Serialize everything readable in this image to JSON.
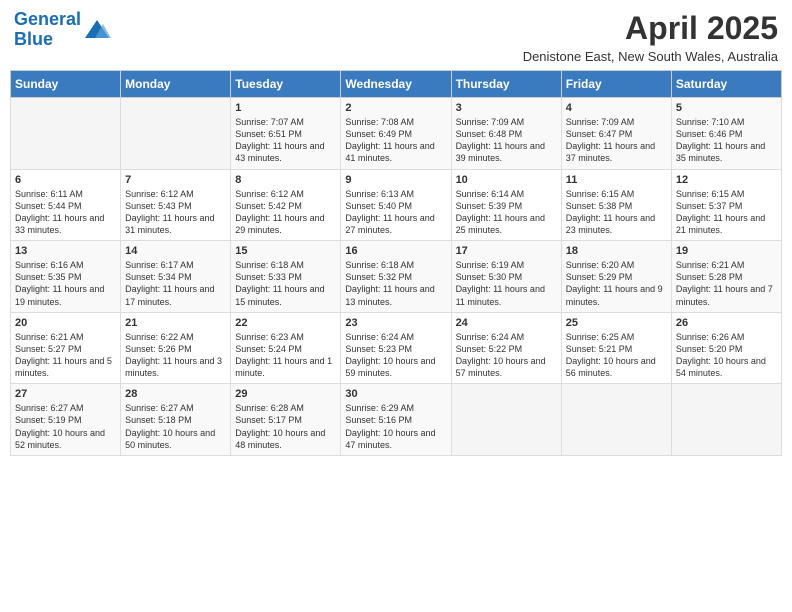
{
  "header": {
    "logo_line1": "General",
    "logo_line2": "Blue",
    "month_title": "April 2025",
    "subtitle": "Denistone East, New South Wales, Australia"
  },
  "weekdays": [
    "Sunday",
    "Monday",
    "Tuesday",
    "Wednesday",
    "Thursday",
    "Friday",
    "Saturday"
  ],
  "weeks": [
    [
      {
        "day": "",
        "info": ""
      },
      {
        "day": "",
        "info": ""
      },
      {
        "day": "1",
        "info": "Sunrise: 7:07 AM\nSunset: 6:51 PM\nDaylight: 11 hours and 43 minutes."
      },
      {
        "day": "2",
        "info": "Sunrise: 7:08 AM\nSunset: 6:49 PM\nDaylight: 11 hours and 41 minutes."
      },
      {
        "day": "3",
        "info": "Sunrise: 7:09 AM\nSunset: 6:48 PM\nDaylight: 11 hours and 39 minutes."
      },
      {
        "day": "4",
        "info": "Sunrise: 7:09 AM\nSunset: 6:47 PM\nDaylight: 11 hours and 37 minutes."
      },
      {
        "day": "5",
        "info": "Sunrise: 7:10 AM\nSunset: 6:46 PM\nDaylight: 11 hours and 35 minutes."
      }
    ],
    [
      {
        "day": "6",
        "info": "Sunrise: 6:11 AM\nSunset: 5:44 PM\nDaylight: 11 hours and 33 minutes."
      },
      {
        "day": "7",
        "info": "Sunrise: 6:12 AM\nSunset: 5:43 PM\nDaylight: 11 hours and 31 minutes."
      },
      {
        "day": "8",
        "info": "Sunrise: 6:12 AM\nSunset: 5:42 PM\nDaylight: 11 hours and 29 minutes."
      },
      {
        "day": "9",
        "info": "Sunrise: 6:13 AM\nSunset: 5:40 PM\nDaylight: 11 hours and 27 minutes."
      },
      {
        "day": "10",
        "info": "Sunrise: 6:14 AM\nSunset: 5:39 PM\nDaylight: 11 hours and 25 minutes."
      },
      {
        "day": "11",
        "info": "Sunrise: 6:15 AM\nSunset: 5:38 PM\nDaylight: 11 hours and 23 minutes."
      },
      {
        "day": "12",
        "info": "Sunrise: 6:15 AM\nSunset: 5:37 PM\nDaylight: 11 hours and 21 minutes."
      }
    ],
    [
      {
        "day": "13",
        "info": "Sunrise: 6:16 AM\nSunset: 5:35 PM\nDaylight: 11 hours and 19 minutes."
      },
      {
        "day": "14",
        "info": "Sunrise: 6:17 AM\nSunset: 5:34 PM\nDaylight: 11 hours and 17 minutes."
      },
      {
        "day": "15",
        "info": "Sunrise: 6:18 AM\nSunset: 5:33 PM\nDaylight: 11 hours and 15 minutes."
      },
      {
        "day": "16",
        "info": "Sunrise: 6:18 AM\nSunset: 5:32 PM\nDaylight: 11 hours and 13 minutes."
      },
      {
        "day": "17",
        "info": "Sunrise: 6:19 AM\nSunset: 5:30 PM\nDaylight: 11 hours and 11 minutes."
      },
      {
        "day": "18",
        "info": "Sunrise: 6:20 AM\nSunset: 5:29 PM\nDaylight: 11 hours and 9 minutes."
      },
      {
        "day": "19",
        "info": "Sunrise: 6:21 AM\nSunset: 5:28 PM\nDaylight: 11 hours and 7 minutes."
      }
    ],
    [
      {
        "day": "20",
        "info": "Sunrise: 6:21 AM\nSunset: 5:27 PM\nDaylight: 11 hours and 5 minutes."
      },
      {
        "day": "21",
        "info": "Sunrise: 6:22 AM\nSunset: 5:26 PM\nDaylight: 11 hours and 3 minutes."
      },
      {
        "day": "22",
        "info": "Sunrise: 6:23 AM\nSunset: 5:24 PM\nDaylight: 11 hours and 1 minute."
      },
      {
        "day": "23",
        "info": "Sunrise: 6:24 AM\nSunset: 5:23 PM\nDaylight: 10 hours and 59 minutes."
      },
      {
        "day": "24",
        "info": "Sunrise: 6:24 AM\nSunset: 5:22 PM\nDaylight: 10 hours and 57 minutes."
      },
      {
        "day": "25",
        "info": "Sunrise: 6:25 AM\nSunset: 5:21 PM\nDaylight: 10 hours and 56 minutes."
      },
      {
        "day": "26",
        "info": "Sunrise: 6:26 AM\nSunset: 5:20 PM\nDaylight: 10 hours and 54 minutes."
      }
    ],
    [
      {
        "day": "27",
        "info": "Sunrise: 6:27 AM\nSunset: 5:19 PM\nDaylight: 10 hours and 52 minutes."
      },
      {
        "day": "28",
        "info": "Sunrise: 6:27 AM\nSunset: 5:18 PM\nDaylight: 10 hours and 50 minutes."
      },
      {
        "day": "29",
        "info": "Sunrise: 6:28 AM\nSunset: 5:17 PM\nDaylight: 10 hours and 48 minutes."
      },
      {
        "day": "30",
        "info": "Sunrise: 6:29 AM\nSunset: 5:16 PM\nDaylight: 10 hours and 47 minutes."
      },
      {
        "day": "",
        "info": ""
      },
      {
        "day": "",
        "info": ""
      },
      {
        "day": "",
        "info": ""
      }
    ]
  ]
}
